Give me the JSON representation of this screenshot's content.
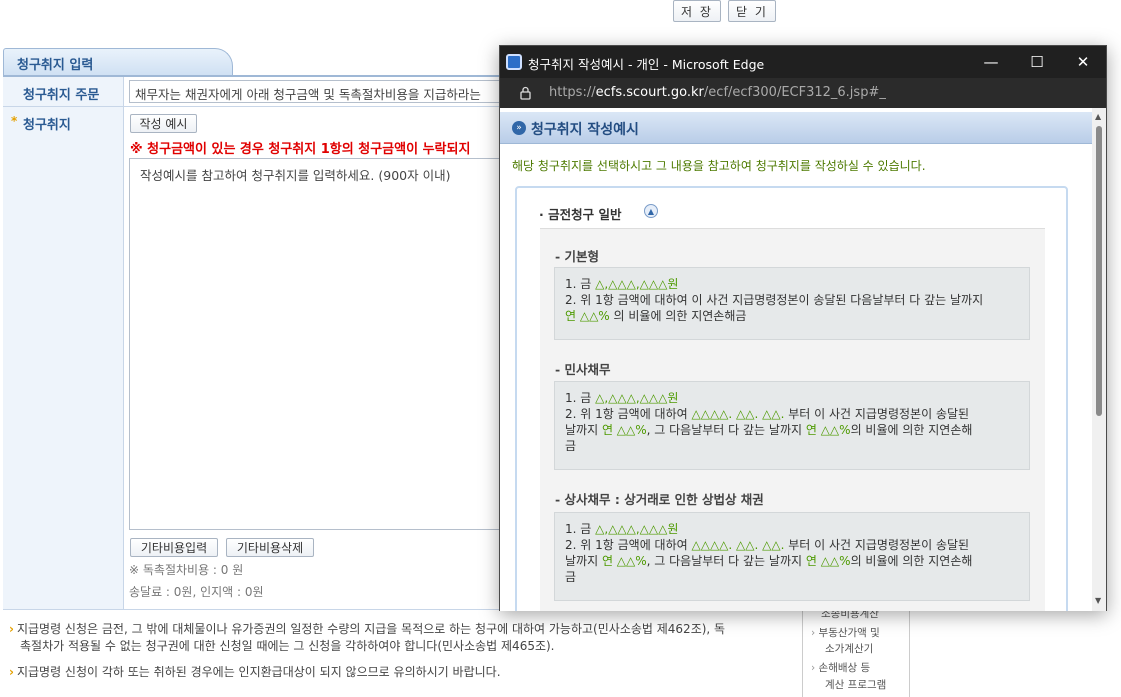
{
  "top_buttons": {
    "save": "저 장",
    "close": "닫 기"
  },
  "form": {
    "tab_title": "청구취지 입력",
    "row1_label": "청구취지 주문",
    "row1_value": "채무자는 채권자에게 아래 청구금액 및 독촉절차비용을 지급하라는",
    "row2_label": "청구취지",
    "required_mark": "*",
    "example_button": "작성 예시",
    "warning": "※ 청구금액이 있는 경우 청구취지 1항의 청구금액이 누락되지",
    "textarea_placeholder": "작성예시를 참고하여 청구취지를 입력하세요. (900자 이내)",
    "other_cost_input_button": "기타비용입력",
    "other_cost_delete_button": "기타비용삭제",
    "procedure_cost": "※ 독촉절차비용 : 0 원",
    "fees": "송달료 : 0원, 인지액 : 0원"
  },
  "notices": [
    "지급명령 신청은 금전, 그 밖에 대체물이나 유가증권의 일정한 수량의 지급을 목적으로 하는 청구에 대하여 가능하고(민사소송법 제462조), 독",
    "촉절차가 적용될 수 없는 청구권에 대한 신청일 때에는 그 신청을 각하하여야 합니다(민사소송법 제465조).",
    "지급명령 신청이 각하 또는 취하된 경우에는 인지환급대상이 되지 않으므로 유의하시기 바랍니다."
  ],
  "side_links": [
    "소송비용계산",
    "부동산가액 및",
    "소가계산기",
    "손해배상 등",
    "계산 프로그램"
  ],
  "popup": {
    "window_title": "청구취지 작성예시 - 개인 - Microsoft Edge",
    "url_prefix": "https://",
    "url_host": "ecfs.scourt.go.kr",
    "url_path": "/ecf/ecf300/ECF312_6.jsp#_",
    "header": "청구취지 작성예시",
    "intro": "해당 청구취지를 선택하시고 그 내용을 참고하여 청구취지를 작성하실 수 있습니다.",
    "section": "· 금전청구 일반",
    "examples": [
      {
        "title": "- 기본형",
        "l1": "1. 금 ",
        "l1g": "△,△△△,△△△원",
        "l2": "2. 위 1항 금액에 대하여 이 사건 지급명령정본이 송달된 다음날부터 다 갚는 날까지",
        "l3g": "연 △△%",
        "l3": " 의 비율에 의한 지연손해금"
      },
      {
        "title": "- 민사채무",
        "l1": "1. 금 ",
        "l1g": "△,△△△,△△△원",
        "l2a": "2. 위 1항 금액에 대하여 ",
        "l2g": "△△△△. △△. △△.",
        "l2b": " 부터 이 사건 지급명령정본이 송달된",
        "l3a": "날까지 ",
        "l3g": "연 △△%",
        "l3b": ", 그 다음날부터 다 갚는 날까지 ",
        "l3g2": "연 △△%",
        "l3c": "의 비율에 의한 지연손해",
        "l4": "금"
      },
      {
        "title": "- 상사채무 : 상거래로 인한 상법상 채권",
        "l1": "1. 금 ",
        "l1g": "△,△△△,△△△원",
        "l2a": "2. 위 1항 금액에 대하여 ",
        "l2g": "△△△△. △△. △△.",
        "l2b": " 부터 이 사건 지급명령정본이 송달된",
        "l3a": "날까지 ",
        "l3g": "연 △△%",
        "l3b": ", 그 다음날부터 다 갚는 날까지 ",
        "l3g2": "연 △△%",
        "l3c": "의 비율에 의한 지연손해",
        "l4": "금"
      }
    ]
  }
}
